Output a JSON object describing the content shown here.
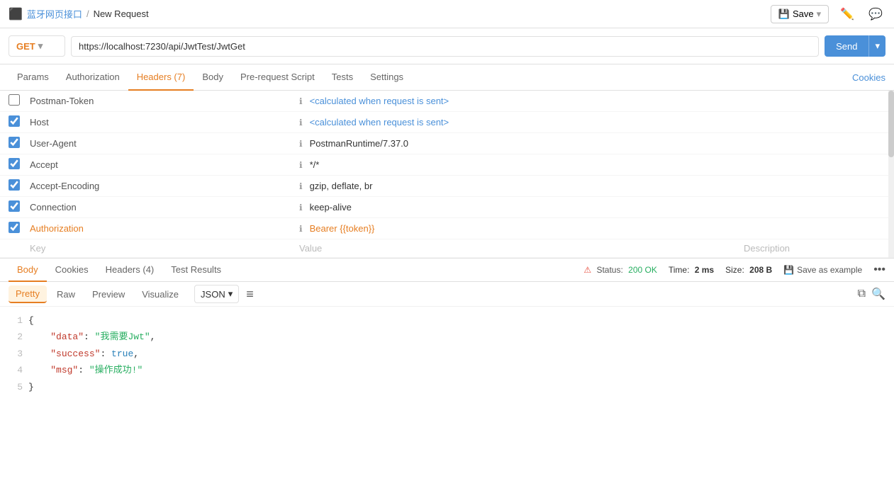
{
  "app": {
    "icon": "🔷",
    "breadcrumb_parent": "蓝牙网页接口",
    "breadcrumb_sep": "/",
    "breadcrumb_current": "New Request",
    "save_label": "Save",
    "edit_icon": "✏️",
    "comment_icon": "💬"
  },
  "url_bar": {
    "method": "GET",
    "url": "https://localhost:7230/api/JwtTest/JwtGet",
    "send_label": "Send"
  },
  "request_tabs": {
    "items": [
      {
        "id": "params",
        "label": "Params"
      },
      {
        "id": "authorization",
        "label": "Authorization"
      },
      {
        "id": "headers",
        "label": "Headers (7)"
      },
      {
        "id": "body",
        "label": "Body"
      },
      {
        "id": "pre-request",
        "label": "Pre-request Script"
      },
      {
        "id": "tests",
        "label": "Tests"
      },
      {
        "id": "settings",
        "label": "Settings"
      }
    ],
    "active": "headers",
    "cookies_label": "Cookies"
  },
  "headers": {
    "rows": [
      {
        "enabled": false,
        "key": "Postman-Token",
        "value": "<calculated when request is sent>",
        "value_color": "blue",
        "disabled": true
      },
      {
        "enabled": true,
        "key": "Host",
        "value": "<calculated when request is sent>",
        "value_color": "blue"
      },
      {
        "enabled": true,
        "key": "User-Agent",
        "value": "PostmanRuntime/7.37.0",
        "value_color": "normal"
      },
      {
        "enabled": true,
        "key": "Accept",
        "value": "*/*",
        "value_color": "normal"
      },
      {
        "enabled": true,
        "key": "Accept-Encoding",
        "value": "gzip, deflate, br",
        "value_color": "normal"
      },
      {
        "enabled": true,
        "key": "Connection",
        "value": "keep-alive",
        "value_color": "normal"
      },
      {
        "enabled": true,
        "key": "Authorization",
        "value": "Bearer {{token}}",
        "value_color": "orange",
        "key_color": "orange"
      }
    ],
    "empty_key": "Key",
    "empty_value": "Value",
    "empty_desc": "Description"
  },
  "response_tabs": {
    "items": [
      {
        "id": "body",
        "label": "Body"
      },
      {
        "id": "cookies",
        "label": "Cookies"
      },
      {
        "id": "headers",
        "label": "Headers (4)"
      },
      {
        "id": "test-results",
        "label": "Test Results"
      }
    ],
    "active": "body",
    "status_label": "Status:",
    "status_value": "200 OK",
    "time_label": "Time:",
    "time_value": "2 ms",
    "size_label": "Size:",
    "size_value": "208 B",
    "save_example_label": "Save as example",
    "more_icon": "•••"
  },
  "format_bar": {
    "tabs": [
      "Pretty",
      "Raw",
      "Preview",
      "Visualize"
    ],
    "active": "Pretty",
    "format": "JSON",
    "wrap_icon": "≡",
    "copy_icon": "⧉",
    "search_icon": "🔍"
  },
  "json_response": {
    "lines": [
      {
        "num": 1,
        "content": "{",
        "type": "brace"
      },
      {
        "num": 2,
        "content": "\"data\": \"我需要Jwt\",",
        "type": "key-string"
      },
      {
        "num": 3,
        "content": "\"success\": true,",
        "type": "key-bool"
      },
      {
        "num": 4,
        "content": "\"msg\": \"操作成功!\"",
        "type": "key-string"
      },
      {
        "num": 5,
        "content": "}",
        "type": "brace"
      }
    ]
  }
}
